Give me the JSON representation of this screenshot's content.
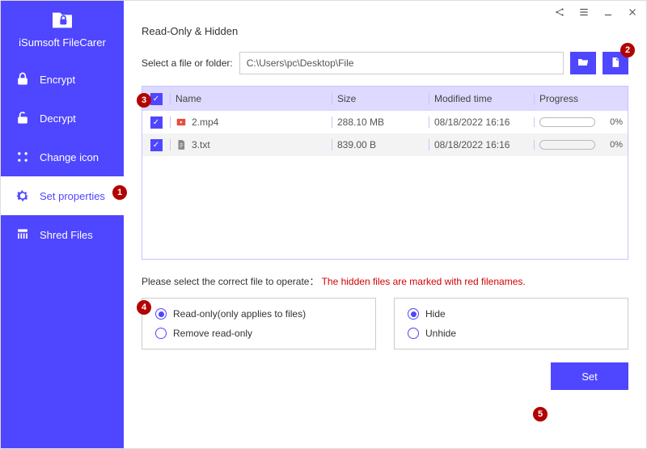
{
  "app": {
    "title": "iSumsoft FileCarer"
  },
  "colors": {
    "accent": "#4f46ff",
    "badge": "#b30000",
    "warning_text": "#d40000"
  },
  "sidebar": {
    "items": [
      {
        "label": "Encrypt",
        "icon": "lock-icon",
        "active": false
      },
      {
        "label": "Decrypt",
        "icon": "unlock-icon",
        "active": false
      },
      {
        "label": "Change icon",
        "icon": "grid-icon",
        "active": false
      },
      {
        "label": "Set properties",
        "icon": "gear-icon",
        "active": true
      },
      {
        "label": "Shred Files",
        "icon": "shred-icon",
        "active": false
      }
    ]
  },
  "titlebar": {
    "buttons": [
      "share-icon",
      "menu-icon",
      "minimize-icon",
      "close-icon"
    ]
  },
  "main": {
    "section_title": "Read-Only & Hidden",
    "path_label": "Select a file or folder:",
    "path_value": "C:\\Users\\pc\\Desktop\\File",
    "table": {
      "columns": [
        "Name",
        "Size",
        "Modified time",
        "Progress"
      ],
      "select_all_checked": true,
      "rows": [
        {
          "checked": true,
          "icon": "video-file-icon",
          "icon_color": "#e74c3c",
          "name": "2.mp4",
          "size": "288.10 MB",
          "modified": "08/18/2022 16:16",
          "progress": 0,
          "progress_label": "0%"
        },
        {
          "checked": true,
          "icon": "text-file-icon",
          "icon_color": "#888888",
          "name": "3.txt",
          "size": "839.00 B",
          "modified": "08/18/2022 16:16",
          "progress": 0,
          "progress_label": "0%"
        }
      ]
    },
    "hint": {
      "prefix": "Please select the correct file to operate：",
      "warning": "The hidden files are marked with red filenames."
    },
    "options": {
      "left": [
        {
          "label": "Read-only(only applies to files)",
          "selected": true
        },
        {
          "label": "Remove read-only",
          "selected": false
        }
      ],
      "right": [
        {
          "label": "Hide",
          "selected": true
        },
        {
          "label": "Unhide",
          "selected": false
        }
      ]
    },
    "set_button": "Set"
  },
  "callouts": [
    "1",
    "2",
    "3",
    "4",
    "5"
  ]
}
